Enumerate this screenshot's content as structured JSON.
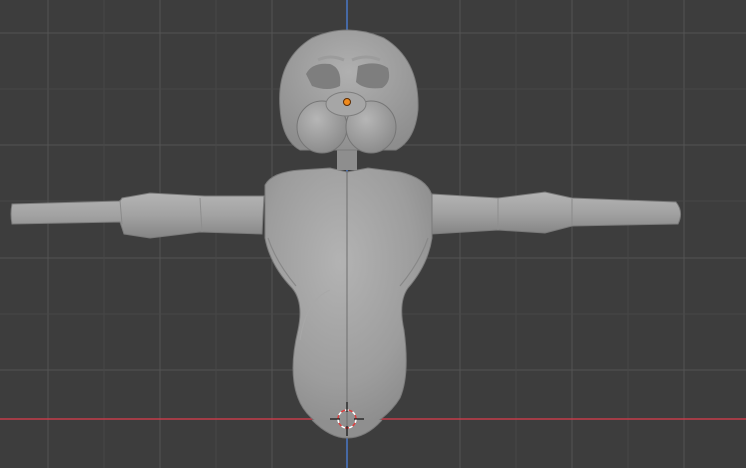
{
  "viewport": {
    "view": "front-orthographic",
    "background_color": "#3d3d3d",
    "grid_color": "#545454",
    "x_axis_color": "#c43c4a",
    "z_axis_color": "#4a78c8",
    "mesh_color": "#9a9a9a",
    "mesh_shadow_color": "#7c7c7c",
    "origin_color": "#f08a1c",
    "cursor_color": "#e04040"
  },
  "scene": {
    "object": "character-mesh",
    "pose": "T-pose",
    "mode": "object"
  }
}
